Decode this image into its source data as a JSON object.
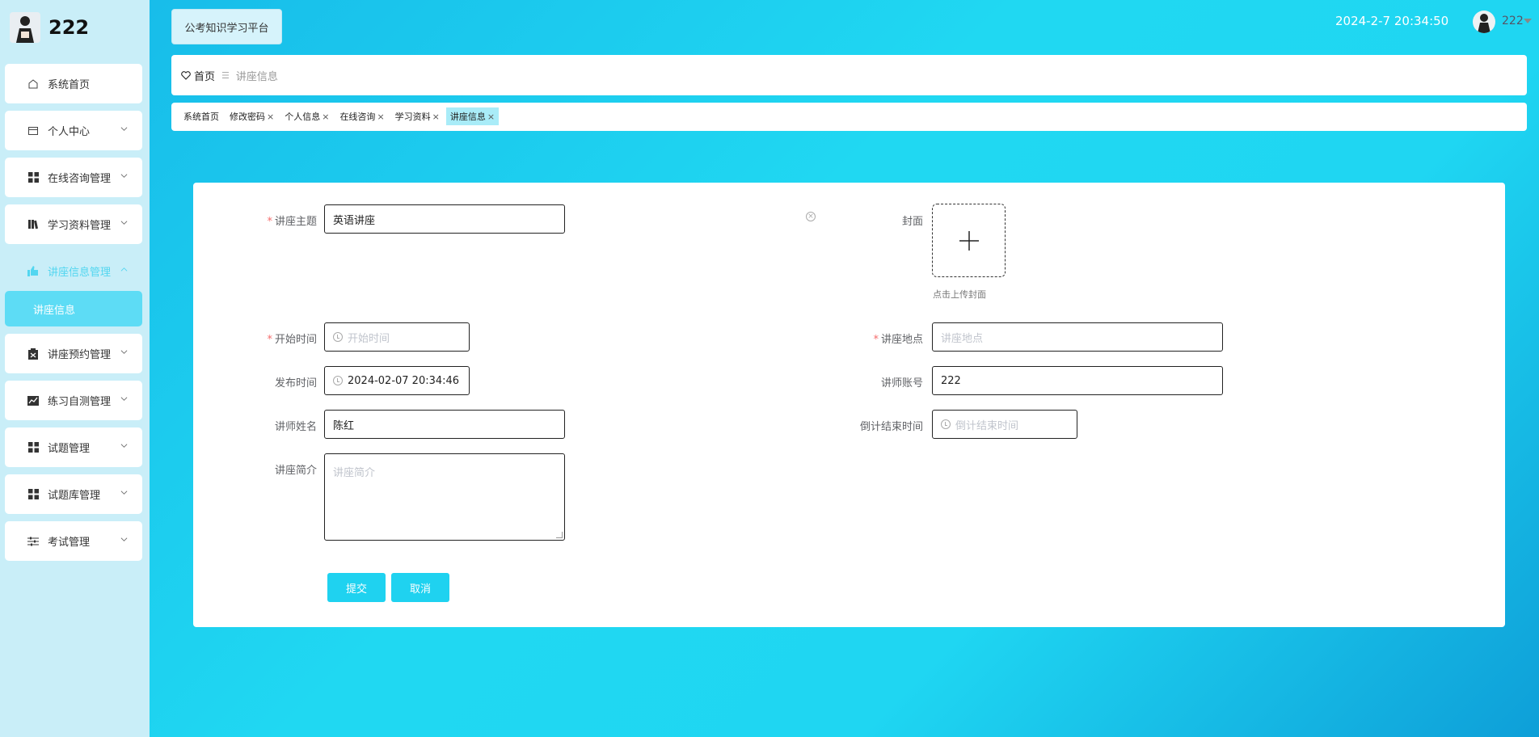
{
  "brand": {
    "name": "222"
  },
  "sidebar": {
    "items": [
      {
        "label": "系统首页"
      },
      {
        "label": "个人中心"
      },
      {
        "label": "在线咨询管理"
      },
      {
        "label": "学习资料管理"
      },
      {
        "label": "讲座信息管理",
        "sub": "讲座信息"
      },
      {
        "label": "讲座预约管理"
      },
      {
        "label": "练习自测管理"
      },
      {
        "label": "试题管理"
      },
      {
        "label": "试题库管理"
      },
      {
        "label": "考试管理"
      }
    ]
  },
  "header": {
    "platform": "公考知识学习平台",
    "datetime": "2024-2-7 20:34:50",
    "user": "222"
  },
  "breadcrumb": {
    "home": "首页",
    "current": "讲座信息"
  },
  "tags": [
    {
      "label": "系统首页"
    },
    {
      "label": "修改密码"
    },
    {
      "label": "个人信息"
    },
    {
      "label": "在线咨询"
    },
    {
      "label": "学习资料"
    },
    {
      "label": "讲座信息"
    }
  ],
  "form": {
    "topic_label": "讲座主题",
    "topic_value": "英语讲座",
    "cover_label": "封面",
    "cover_hint": "点击上传封面",
    "start_label": "开始时间",
    "start_placeholder": "开始时间",
    "location_label": "讲座地点",
    "location_placeholder": "讲座地点",
    "publish_label": "发布时间",
    "publish_value": "2024-02-07 20:34:46",
    "account_label": "讲师账号",
    "account_value": "222",
    "name_label": "讲师姓名",
    "name_value": "陈红",
    "countdown_label": "倒计结束时间",
    "countdown_placeholder": "倒计结束时间",
    "intro_label": "讲座简介",
    "intro_placeholder": "讲座简介",
    "submit": "提交",
    "cancel": "取消"
  },
  "colors": {
    "accent": "#1fd2f0",
    "sidebar_bg": "#c9eef8",
    "active_sub": "#5ddcf5",
    "required": "#f56c6c"
  }
}
